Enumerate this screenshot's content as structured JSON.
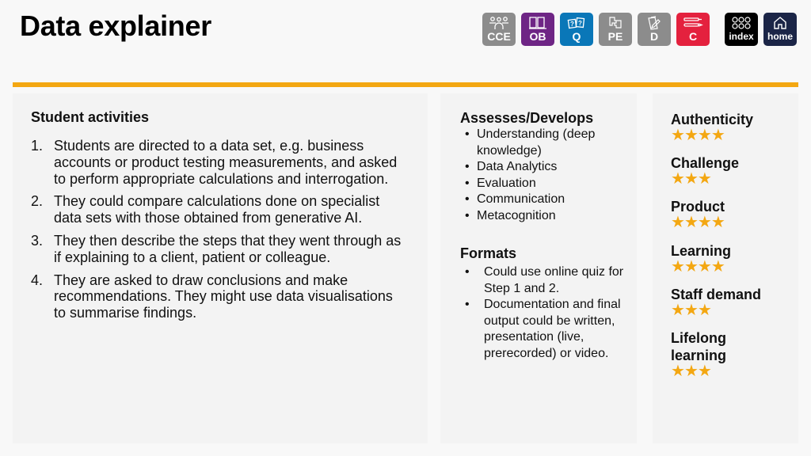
{
  "header": {
    "title": "Data explainer"
  },
  "nav": {
    "buttons": [
      {
        "label": "CCE",
        "icon": "people-group-icon",
        "color": "#8c8c8c"
      },
      {
        "label": "OB",
        "icon": "open-book-icon",
        "color": "#6e2585"
      },
      {
        "label": "Q",
        "icon": "question-cards-icon",
        "color": "#0a77b8"
      },
      {
        "label": "PE",
        "icon": "puzzle-icon",
        "color": "#8c8c8c"
      },
      {
        "label": "D",
        "icon": "document-pencil-icon",
        "color": "#8c8c8c"
      },
      {
        "label": "C",
        "icon": "pens-icon",
        "color": "#e4213e"
      },
      {
        "label": "index",
        "icon": "grid-circles-icon",
        "color": "#000000"
      },
      {
        "label": "home",
        "icon": "house-icon",
        "color": "#1b2547"
      }
    ]
  },
  "accent_color": "#f3a712",
  "student_activities": {
    "title": "Student activities",
    "items": [
      {
        "num": "1.",
        "text": "Students are directed to a data set, e.g. business accounts or product testing measurements, and asked to perform appropriate calculations and interrogation."
      },
      {
        "num": "2.",
        "text": "They could compare calculations done on specialist data sets with those obtained from generative AI."
      },
      {
        "num": "3.",
        "text": "They then describe the steps that they went through as if explaining to a client, patient or colleague."
      },
      {
        "num": "4.",
        "text": "They are asked to draw conclusions and make recommendations. They might use data visualisations to summarise findings."
      }
    ]
  },
  "assesses": {
    "title": "Assesses/Develops",
    "items": [
      "Understanding (deep knowledge)",
      "Data Analytics",
      "Evaluation",
      "Communication",
      "Metacognition"
    ]
  },
  "formats": {
    "title": "Formats",
    "items": [
      "Could use online quiz for Step 1 and 2.",
      "Documentation and final output could be written, presentation (live, prerecorded) or video."
    ]
  },
  "ratings": [
    {
      "name": "Authenticity",
      "stars": 4,
      "max": 4
    },
    {
      "name": "Challenge",
      "stars": 3,
      "max": 4
    },
    {
      "name": "Product",
      "stars": 4,
      "max": 4
    },
    {
      "name": "Learning",
      "stars": 4,
      "max": 4
    },
    {
      "name": "Staff demand",
      "stars": 3,
      "max": 4
    },
    {
      "name": "Lifelong learning",
      "stars": 3,
      "max": 4
    }
  ]
}
